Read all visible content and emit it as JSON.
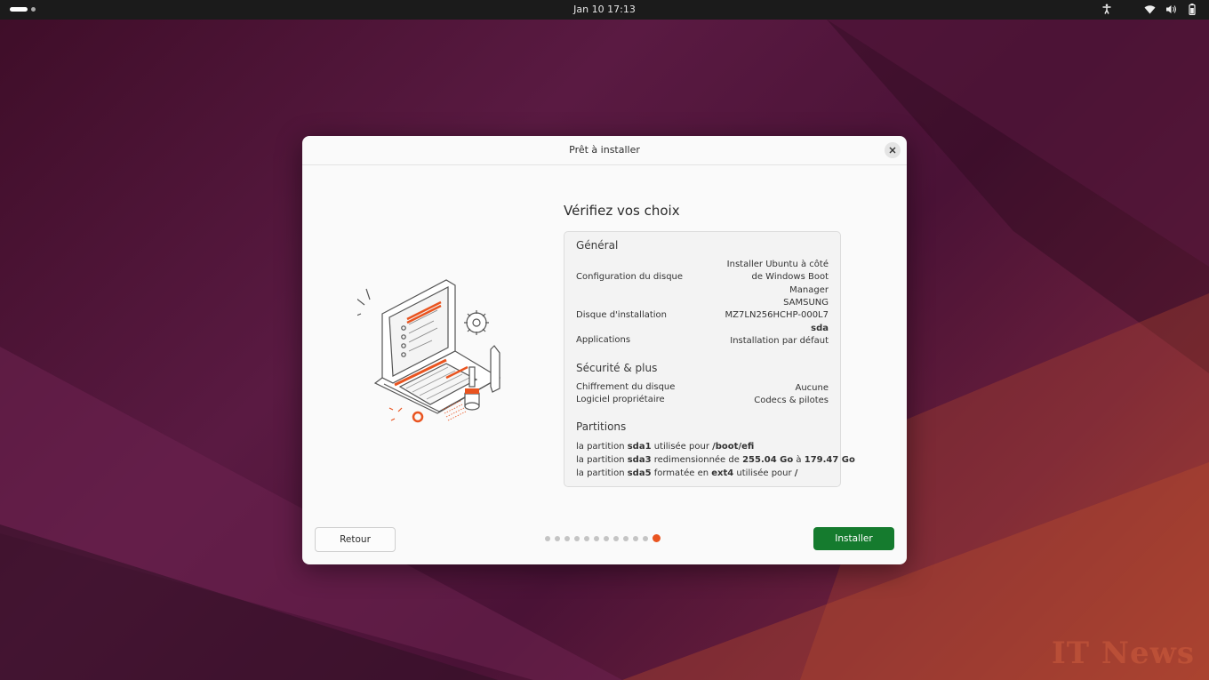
{
  "topbar": {
    "clock": "Jan 10  17:13",
    "icons": [
      "accessibility-icon",
      "wifi-icon",
      "volume-icon",
      "battery-icon"
    ]
  },
  "dialog": {
    "title": "Prêt à installer",
    "heading": "Vérifiez vos choix",
    "general": {
      "title": "Général",
      "disk_config_label": "Configuration du disque",
      "disk_config_value": [
        "Installer Ubuntu à côté",
        "de Windows Boot",
        "Manager"
      ],
      "install_disk_label": "Disque d'installation",
      "install_disk_value": [
        "SAMSUNG",
        "MZ7LN256HCHP-000L7",
        "sda"
      ],
      "apps_label": "Applications",
      "apps_value": "Installation par défaut"
    },
    "security": {
      "title": "Sécurité & plus",
      "encryption_label": "Chiffrement du disque",
      "encryption_value": "Aucune",
      "proprietary_label": "Logiciel propriétaire",
      "proprietary_value": "Codecs & pilotes"
    },
    "partitions": {
      "title": "Partitions",
      "lines": [
        {
          "prefix": "la partition ",
          "part": "sda1",
          "middle": " utilisée pour ",
          "target": "/boot/efi",
          "middle2": "",
          "target2": ""
        },
        {
          "prefix": "la partition ",
          "part": "sda3",
          "middle": " redimensionnée de ",
          "target": "255.04 Go",
          "middle2": " à ",
          "target2": "179.47 Go"
        },
        {
          "prefix": "la partition ",
          "part": "sda5",
          "middle": " formatée en ",
          "target": "ext4",
          "middle2": " utilisée pour ",
          "target2": "/"
        }
      ]
    },
    "back_label": "Retour",
    "install_label": "Installer",
    "steps_total": 12,
    "steps_current": 12
  },
  "watermark": "IT News",
  "colors": {
    "accent": "#e95420",
    "install_button": "#157b2e"
  }
}
